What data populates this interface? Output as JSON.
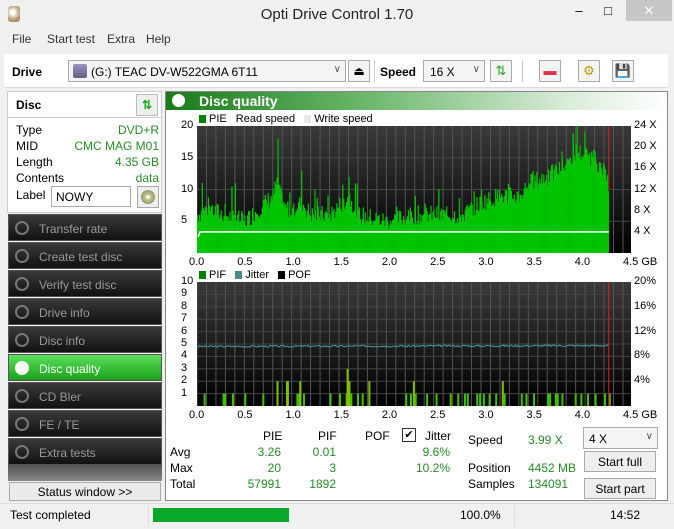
{
  "window": {
    "title": "Opti Drive Control 1.70",
    "min": "–",
    "max": "□",
    "close": "✕"
  },
  "menu": [
    "File",
    "Start test",
    "Extra",
    "Help"
  ],
  "toolbar": {
    "drive_label": "Drive",
    "drive_value": "(G:)  TEAC DV-W522GMA 6T11",
    "speed_label": "Speed",
    "speed_value": "16 X",
    "eject": "⏏"
  },
  "disc": {
    "title": "Disc",
    "rows": [
      {
        "k": "Type",
        "v": "DVD+R"
      },
      {
        "k": "MID",
        "v": "CMC MAG M01"
      },
      {
        "k": "Length",
        "v": "4.35 GB"
      },
      {
        "k": "Contents",
        "v": "data"
      }
    ],
    "label_key": "Label",
    "label_value": "NOWY"
  },
  "nav": [
    "Transfer rate",
    "Create test disc",
    "Verify test disc",
    "Drive info",
    "Disc info",
    "Disc quality",
    "CD Bler",
    "FE / TE",
    "Extra tests"
  ],
  "nav_active": "Disc quality",
  "status_button": "Status window >>",
  "panel": {
    "title": "Disc quality"
  },
  "chart_data": [
    {
      "type": "bar",
      "title": "PIE",
      "legend": [
        "PIE",
        "Read speed",
        "Write speed"
      ],
      "legend_colors": [
        "#008000",
        "#000000",
        "#f0f0f0"
      ],
      "x_ticks": [
        "0.0",
        "0.5",
        "1.0",
        "1.5",
        "2.0",
        "2.5",
        "3.0",
        "3.5",
        "4.0",
        "4.5 GB"
      ],
      "xlim": [
        0,
        4.5
      ],
      "y_ticks": [
        "5",
        "10",
        "15",
        "20"
      ],
      "ylim": [
        0,
        20
      ],
      "y2_ticks": [
        "4 X",
        "8 X",
        "12 X",
        "16 X",
        "20 X",
        "24 X"
      ],
      "y2lim": [
        0,
        24
      ],
      "read_speed_x": 3.99,
      "end_marker_gb": 4.35,
      "profile": [
        [
          0,
          6
        ],
        [
          0.1,
          7
        ],
        [
          0.3,
          6
        ],
        [
          0.5,
          5
        ],
        [
          0.8,
          9
        ],
        [
          0.85,
          12
        ],
        [
          0.9,
          7
        ],
        [
          1.0,
          7
        ],
        [
          1.1,
          8
        ],
        [
          1.2,
          6
        ],
        [
          1.4,
          6
        ],
        [
          1.6,
          9
        ],
        [
          1.7,
          6
        ],
        [
          2.0,
          5
        ],
        [
          2.3,
          6
        ],
        [
          2.5,
          6
        ],
        [
          2.8,
          6
        ],
        [
          3.0,
          8
        ],
        [
          3.2,
          9
        ],
        [
          3.4,
          9
        ],
        [
          3.5,
          11
        ],
        [
          3.7,
          12
        ],
        [
          3.9,
          14
        ],
        [
          4.0,
          16
        ],
        [
          4.2,
          15
        ],
        [
          4.35,
          11
        ]
      ],
      "peaks": [
        [
          0.05,
          11
        ],
        [
          0.4,
          11
        ],
        [
          0.85,
          18
        ],
        [
          1.1,
          13
        ],
        [
          1.24,
          10
        ],
        [
          1.6,
          12
        ],
        [
          2.3,
          9
        ],
        [
          3.0,
          10
        ],
        [
          3.5,
          11
        ],
        [
          3.85,
          16
        ],
        [
          3.97,
          18
        ],
        [
          4.01,
          20
        ],
        [
          4.2,
          16
        ]
      ]
    },
    {
      "type": "bar",
      "title": "PIF / Jitter",
      "legend": [
        "PIF",
        "Jitter",
        "POF"
      ],
      "legend_colors": [
        "#008000",
        "#4a8a8a",
        "#000000"
      ],
      "x_ticks": [
        "0.0",
        "0.5",
        "1.0",
        "1.5",
        "2.0",
        "2.5",
        "3.0",
        "3.5",
        "4.0",
        "4.5 GB"
      ],
      "xlim": [
        0,
        4.5
      ],
      "y_ticks": [
        "1",
        "2",
        "3",
        "4",
        "5",
        "6",
        "7",
        "8",
        "9",
        "10"
      ],
      "ylim": [
        0,
        10
      ],
      "y2_ticks": [
        "4%",
        "8%",
        "12%",
        "16%",
        "20%"
      ],
      "y2lim": [
        0,
        20
      ],
      "pif": [
        [
          0.07,
          1
        ],
        [
          0.27,
          1
        ],
        [
          0.29,
          1
        ],
        [
          0.37,
          1
        ],
        [
          0.5,
          1
        ],
        [
          0.69,
          1
        ],
        [
          0.84,
          2
        ],
        [
          0.94,
          2
        ],
        [
          0.95,
          2
        ],
        [
          1.05,
          1
        ],
        [
          1.07,
          1
        ],
        [
          1.08,
          2
        ],
        [
          1.12,
          1
        ],
        [
          1.4,
          1
        ],
        [
          1.5,
          1
        ],
        [
          1.57,
          1
        ],
        [
          1.58,
          3
        ],
        [
          1.6,
          2
        ],
        [
          1.62,
          1
        ],
        [
          1.69,
          1
        ],
        [
          1.74,
          1
        ],
        [
          1.81,
          2
        ],
        [
          2.2,
          1
        ],
        [
          2.25,
          1
        ],
        [
          2.28,
          2
        ],
        [
          2.3,
          1
        ],
        [
          2.42,
          1
        ],
        [
          2.52,
          1
        ],
        [
          2.67,
          1
        ],
        [
          2.75,
          1
        ],
        [
          2.82,
          1
        ],
        [
          2.85,
          1
        ],
        [
          2.95,
          1
        ],
        [
          2.98,
          1
        ],
        [
          3.02,
          1
        ],
        [
          3.08,
          1
        ],
        [
          3.15,
          1
        ],
        [
          3.22,
          2
        ],
        [
          3.24,
          1
        ],
        [
          3.42,
          1
        ],
        [
          3.47,
          1
        ],
        [
          3.55,
          1
        ],
        [
          3.7,
          1
        ],
        [
          3.72,
          1
        ],
        [
          3.78,
          1
        ],
        [
          3.8,
          1
        ],
        [
          3.85,
          1
        ],
        [
          3.99,
          1
        ],
        [
          4.05,
          1
        ],
        [
          4.12,
          1
        ],
        [
          4.2,
          1
        ],
        [
          4.3,
          1
        ],
        [
          4.35,
          1
        ]
      ],
      "jitter_pct": 9.6,
      "end_marker_gb": 4.35
    }
  ],
  "stats": {
    "headers": [
      "PIE",
      "PIF",
      "POF",
      "Jitter"
    ],
    "jitter_checked": true,
    "rows": [
      {
        "k": "Avg",
        "pie": "3.26",
        "pif": "0.01",
        "pof": "",
        "jitter": "9.6%"
      },
      {
        "k": "Max",
        "pie": "20",
        "pif": "3",
        "pof": "",
        "jitter": "10.2%"
      },
      {
        "k": "Total",
        "pie": "57991",
        "pif": "1892",
        "pof": "",
        "jitter": ""
      }
    ],
    "speed_label": "Speed",
    "speed_value": "3.99 X",
    "position_label": "Position",
    "position_value": "4452 MB",
    "samples_label": "Samples",
    "samples_value": "134091",
    "speed_select": "4 X",
    "start_full": "Start full",
    "start_part": "Start part"
  },
  "statusbar": {
    "text": "Test completed",
    "progress": 1.0,
    "percent": "100.0%",
    "time": "14:52"
  }
}
